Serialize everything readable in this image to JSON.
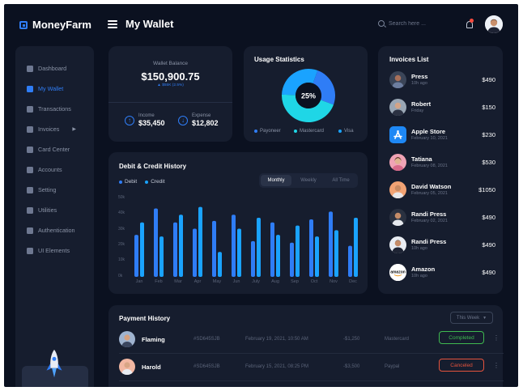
{
  "app": {
    "name": "MoneyFarm",
    "page_title": "My Wallet"
  },
  "search": {
    "placeholder": "Search here ..."
  },
  "sidebar": {
    "items": [
      {
        "label": "Dashboard",
        "icon": "dashboard-icon",
        "active": false
      },
      {
        "label": "My Wallet",
        "icon": "wallet-icon",
        "active": true
      },
      {
        "label": "Transactions",
        "icon": "transactions-icon",
        "active": false
      },
      {
        "label": "Invoices",
        "icon": "invoices-icon",
        "active": false,
        "has_submenu": true
      },
      {
        "label": "Card Center",
        "icon": "card-icon",
        "active": false
      },
      {
        "label": "Accounts",
        "icon": "user-icon",
        "active": false
      },
      {
        "label": "Setting",
        "icon": "gear-icon",
        "active": false
      },
      {
        "label": "Utilities",
        "icon": "utilities-icon",
        "active": false
      },
      {
        "label": "Authentication",
        "icon": "lock-icon",
        "active": false
      },
      {
        "label": "UI Elements",
        "icon": "elements-icon",
        "active": false
      }
    ]
  },
  "wallet": {
    "label": "Wallet Balance",
    "amount": "$150,900.75",
    "change": "▲ $55K (2.5%)",
    "income_label": "Income",
    "income_value": "$35,450",
    "expense_label": "Expense",
    "expense_value": "$12,802"
  },
  "usage": {
    "title": "Usage Statistics",
    "center_label": "25%",
    "legend": [
      "Payoneer",
      "Mastercard",
      "Visa"
    ],
    "colors": [
      "#2f7df6",
      "#1fd6e6",
      "#1aa3ff"
    ],
    "slices": [
      {
        "name": "Payoneer",
        "value": 25
      },
      {
        "name": "Mastercard",
        "value": 45
      },
      {
        "name": "Visa",
        "value": 30
      }
    ]
  },
  "invoices": {
    "title": "Invoices List",
    "items": [
      {
        "name": "Press",
        "date": "10h ago",
        "amount": "$490"
      },
      {
        "name": "Robert",
        "date": "Friday",
        "amount": "$150"
      },
      {
        "name": "Apple Store",
        "date": "February 10, 2021",
        "amount": "$230"
      },
      {
        "name": "Tatiana",
        "date": "February 08, 2021",
        "amount": "$530"
      },
      {
        "name": "David Watson",
        "date": "February 05, 2021",
        "amount": "$1050"
      },
      {
        "name": "Randi Press",
        "date": "February 02, 2021",
        "amount": "$490"
      },
      {
        "name": "Randi Press",
        "date": "10h ago",
        "amount": "$490"
      },
      {
        "name": "Amazon",
        "date": "10h ago",
        "amount": "$490",
        "logo_text": "amazon"
      }
    ]
  },
  "history": {
    "title": "Debit & Credit History",
    "tabs": [
      "Monthly",
      "Weekly",
      "All Time"
    ],
    "active_tab": "Monthly"
  },
  "chart_data": {
    "type": "bar",
    "categories": [
      "Jan",
      "Feb",
      "Mar",
      "Apr",
      "May",
      "Jun",
      "July",
      "Aug",
      "Sep",
      "Oct",
      "Nov",
      "Dec"
    ],
    "series": [
      {
        "name": "Debit",
        "color": "#2f7df6",
        "values": [
          27,
          44,
          35,
          31,
          36,
          40,
          23,
          35,
          22,
          37,
          42,
          20
        ]
      },
      {
        "name": "Credit",
        "color": "#1aa3ff",
        "values": [
          35,
          26,
          40,
          45,
          16,
          31,
          38,
          27,
          33,
          26,
          30,
          38
        ]
      }
    ],
    "ylim": [
      0,
      50
    ],
    "yticks": [
      "0k",
      "10k",
      "20k",
      "30k",
      "40k",
      "50k"
    ]
  },
  "payments": {
    "title": "Payment History",
    "filter": "This Week",
    "rows": [
      {
        "name": "Flaming",
        "id": "#SD645SJB",
        "date": "February 19, 2021, 10:50 AM",
        "amount": "-$1,250",
        "method": "Mastercard",
        "status": "Completed"
      },
      {
        "name": "Harold",
        "id": "#SD645SJB",
        "date": "February 15, 2021, 08:25 PM",
        "amount": "-$3,500",
        "method": "Paypal",
        "status": "Canceled"
      }
    ]
  }
}
